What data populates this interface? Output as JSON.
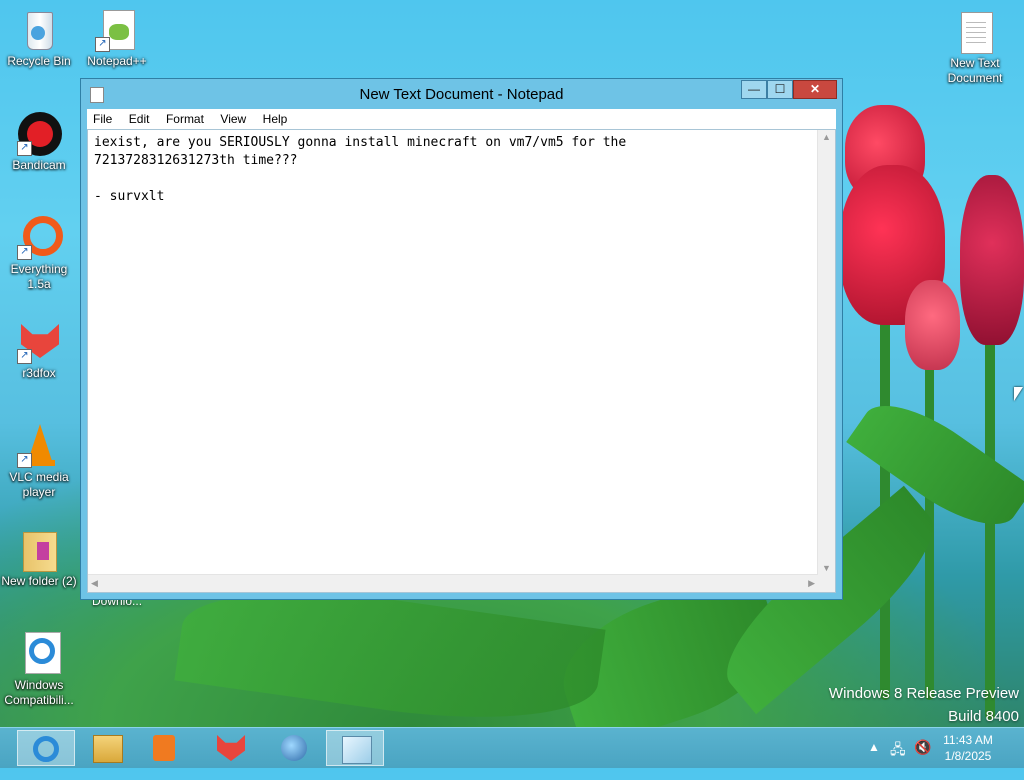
{
  "desktop": {
    "icons": [
      {
        "label": "Recycle Bin"
      },
      {
        "label": "Notepad++"
      },
      {
        "label": "Bandicam"
      },
      {
        "label": "Everything 1.5a"
      },
      {
        "label": "r3dfox"
      },
      {
        "label": "VLC media player"
      },
      {
        "label": "New folder (2)"
      },
      {
        "label": "Windows Compatibili..."
      },
      {
        "label": "New Text Document"
      }
    ],
    "hidden_label": "Downlo..."
  },
  "window": {
    "title": "New Text Document - Notepad",
    "buttons": {
      "minimize": "—",
      "maximize": "☐",
      "close": "✕"
    },
    "menu": [
      "File",
      "Edit",
      "Format",
      "View",
      "Help"
    ],
    "content": "iexist, are you SERIOUSLY gonna install minecraft on vm7/vm5 for the\n7213728312631273th time???\n\n- survxlt"
  },
  "watermark": {
    "line1": "Windows 8 Release Preview",
    "line2": "Build 8400"
  },
  "taskbar": {
    "apps": [
      {
        "icon": "internet-explorer-icon"
      },
      {
        "icon": "file-explorer-icon"
      },
      {
        "icon": "media-player-icon"
      },
      {
        "icon": "r3dfox-icon"
      },
      {
        "icon": "browser-globe-icon"
      },
      {
        "icon": "notepad-icon"
      }
    ],
    "clock": {
      "time": "11:43 AM",
      "date": "1/8/2025"
    }
  }
}
